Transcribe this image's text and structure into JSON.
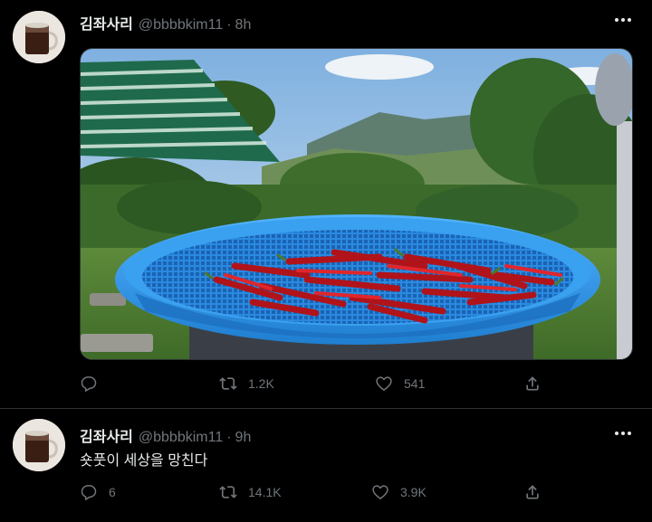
{
  "tweets": [
    {
      "name": "김좌사리",
      "handle": "@bbbbkim11",
      "separator": "·",
      "time": "8h",
      "text": "",
      "media": "photo-chili-peppers-drying-in-blue-basket",
      "stats": {
        "replies": "",
        "retweets": "1.2K",
        "likes": "541"
      }
    },
    {
      "name": "김좌사리",
      "handle": "@bbbbkim11",
      "separator": "·",
      "time": "9h",
      "text": "숏풋이 세상을 망친다",
      "stats": {
        "replies": "6",
        "retweets": "14.1K",
        "likes": "3.9K"
      }
    }
  ],
  "icons": [
    "reply-icon",
    "retweet-icon",
    "like-icon",
    "share-icon",
    "more-icon"
  ],
  "colors": {
    "background": "#000000",
    "text": "#e7e9ea",
    "muted": "#71767b",
    "basket": "#2f8fd8"
  }
}
